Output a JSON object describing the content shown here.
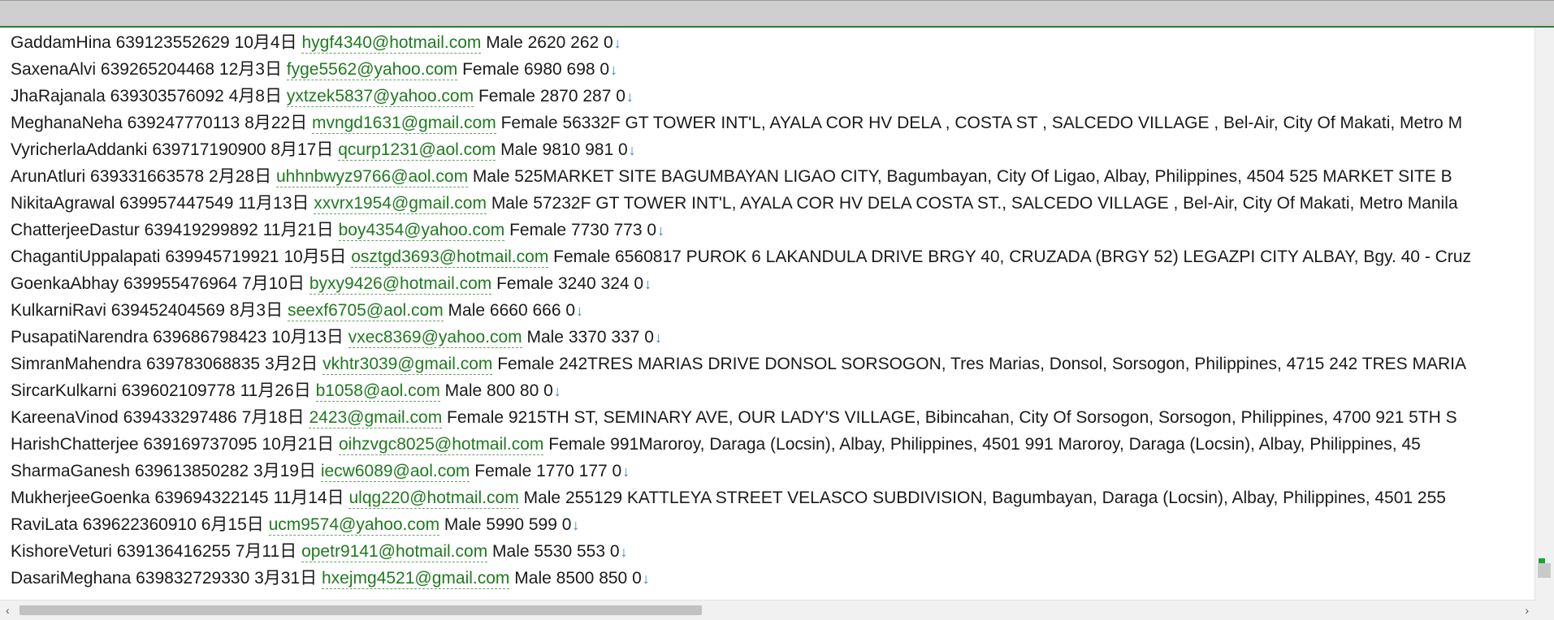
{
  "lines": [
    {
      "name": "GaddamHina",
      "phone": "639123552629",
      "date": "10月4日",
      "email": "hygf4340@hotmail.com",
      "gender": "Male",
      "rest": "2620  262  0"
    },
    {
      "name": "SaxenaAlvi",
      "phone": "639265204468",
      "date": "12月3日",
      "email": "fyge5562@yahoo.com",
      "gender": "Female",
      "rest": "6980  698  0"
    },
    {
      "name": "JhaRajanala",
      "phone": "639303576092",
      "date": "4月8日",
      "email": "yxtzek5837@yahoo.com",
      "gender": "Female",
      "rest": "2870  287  0"
    },
    {
      "name": "MeghanaNeha",
      "phone": "639247770113",
      "date": "8月22日",
      "email": "mvngd1631@gmail.com",
      "gender": "Female",
      "rest": "56332F GT TOWER INT'L, AYALA COR HV DELA , COSTA ST , SALCEDO VILLAGE , Bel-Air, City Of Makati, Metro M"
    },
    {
      "name": "VyricherlaAddanki",
      "phone": "639717190900",
      "date": "8月17日",
      "email": "qcurp1231@aol.com",
      "gender": "Male",
      "rest": "9810  981  0"
    },
    {
      "name": "ArunAtluri",
      "phone": "639331663578",
      "date": "2月28日",
      "email": "uhhnbwyz9766@aol.com",
      "gender": "Male",
      "rest": "525MARKET SITE BAGUMBAYAN LIGAO CITY, Bagumbayan, City Of Ligao, Albay, Philippines, 4504  525  MARKET SITE B"
    },
    {
      "name": "NikitaAgrawal",
      "phone": "639957447549",
      "date": "11月13日",
      "email": "xxvrx1954@gmail.com",
      "gender": "Male",
      "rest": "57232F GT TOWER INT'L, AYALA COR HV DELA COSTA ST., SALCEDO VILLAGE , Bel-Air, City Of Makati, Metro Manila"
    },
    {
      "name": "ChatterjeeDastur",
      "phone": "639419299892",
      "date": "11月21日",
      "email": "boy4354@yahoo.com",
      "gender": "Female",
      "rest": "7730  773  0"
    },
    {
      "name": "ChagantiUppalapati",
      "phone": "639945719921",
      "date": "10月5日",
      "email": "osztgd3693@hotmail.com",
      "gender": "Female",
      "rest": "6560817 PUROK 6 LAKANDULA DRIVE BRGY 40, CRUZADA (BRGY 52) LEGAZPI CITY ALBAY, Bgy. 40 - Cruz"
    },
    {
      "name": "GoenkaAbhay",
      "phone": "639955476964",
      "date": "7月10日",
      "email": "byxy9426@hotmail.com",
      "gender": "Female",
      "rest": "3240  324  0"
    },
    {
      "name": "KulkarniRavi",
      "phone": "639452404569",
      "date": "8月3日",
      "email": "seexf6705@aol.com",
      "gender": "Male",
      "rest": "6660  666  0"
    },
    {
      "name": "PusapatiNarendra",
      "phone": "639686798423",
      "date": "10月13日",
      "email": "vxec8369@yahoo.com",
      "gender": "Male",
      "rest": "3370  337  0"
    },
    {
      "name": "SimranMahendra",
      "phone": "639783068835",
      "date": "3月2日",
      "email": "vkhtr3039@gmail.com",
      "gender": "Female",
      "rest": "242TRES MARIAS DRIVE DONSOL SORSOGON, Tres Marias, Donsol, Sorsogon, Philippines, 4715  242  TRES MARIA"
    },
    {
      "name": "SircarKulkarni",
      "phone": "639602109778",
      "date": "11月26日",
      "email": "b1058@aol.com",
      "gender": "Male",
      "rest": "800  80  0"
    },
    {
      "name": "KareenaVinod",
      "phone": "639433297486",
      "date": "7月18日",
      "email": "2423@gmail.com",
      "gender": "Female",
      "rest": "9215TH ST, SEMINARY AVE, OUR LADY'S VILLAGE, Bibincahan, City Of Sorsogon, Sorsogon, Philippines, 4700  921  5TH S"
    },
    {
      "name": "HarishChatterjee",
      "phone": "639169737095",
      "date": "10月21日",
      "email": "oihzvgc8025@hotmail.com",
      "gender": "Female",
      "rest": "991Maroroy, Daraga (Locsin), Albay, Philippines, 4501  991  Maroroy, Daraga (Locsin), Albay, Philippines, 45"
    },
    {
      "name": "SharmaGanesh",
      "phone": "639613850282",
      "date": "3月19日",
      "email": "iecw6089@aol.com",
      "gender": "Female",
      "rest": "1770  177  0"
    },
    {
      "name": "MukherjeeGoenka",
      "phone": "639694322145",
      "date": "11月14日",
      "email": "ulqg220@hotmail.com",
      "gender": "Male",
      "rest": "255129 KATTLEYA STREET VELASCO SUBDIVISION, Bagumbayan, Daraga (Locsin), Albay, Philippines, 4501  255"
    },
    {
      "name": "RaviLata",
      "phone": "639622360910",
      "date": "6月15日",
      "email": "ucm9574@yahoo.com",
      "gender": "Male",
      "rest": "5990  599  0"
    },
    {
      "name": "KishoreVeturi",
      "phone": "639136416255",
      "date": "7月11日",
      "email": "opetr9141@hotmail.com",
      "gender": "Male",
      "rest": "5530  553  0"
    },
    {
      "name": "DasariMeghana",
      "phone": "639832729330",
      "date": "3月31日",
      "email": "hxejmg4521@gmail.com",
      "gender": "Male",
      "rest": "8500  850  0"
    }
  ],
  "return_mark": "↓",
  "icons": {
    "scroll_left": "chevron-left-icon",
    "scroll_right": "chevron-right-icon"
  },
  "colors": {
    "email": "#1f7a1f",
    "mark": "#3b7fd6",
    "accent_rule": "#2d7d3a"
  }
}
